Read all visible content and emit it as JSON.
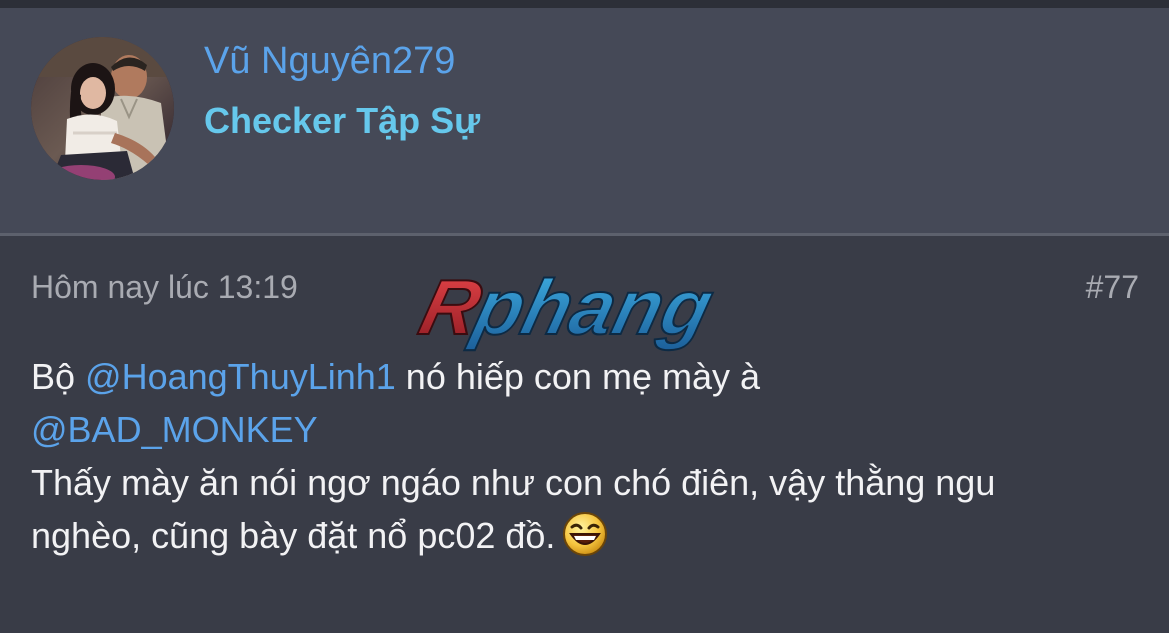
{
  "user": {
    "name": "Vũ Nguyên279",
    "title": "Checker Tập Sự",
    "avatar_icon": "user-photo-avatar"
  },
  "post": {
    "date": "Hôm nay lúc 13:19",
    "number": "#77",
    "line1_prefix": "Bộ ",
    "mention1": "@HoangThuyLinh1",
    "line1_suffix": " nó hiếp con mẹ mày à",
    "mention2": "@BAD_MONKEY",
    "line3": "Thấy mày ăn nói ngơ ngáo như con chó điên, vậy thằng ngu",
    "line4": "nghèo, cũng bày đặt nổ pc02 đồ.",
    "emoji_icon": "laughing-emoji-icon"
  },
  "watermark": {
    "text": "Rphang"
  },
  "colors": {
    "mention": "#5ba3ea",
    "username": "#5ba3ea",
    "usertitle": "#66c8ec",
    "background": "#393c47",
    "panel": "#454957"
  }
}
